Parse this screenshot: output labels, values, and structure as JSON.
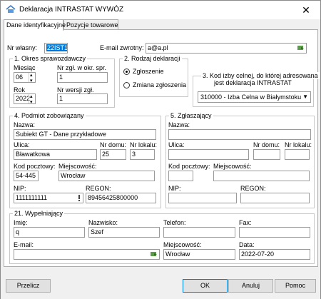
{
  "window": {
    "title": "Deklaracja INTRASTAT WYWÓZ",
    "close": "✕"
  },
  "tabs": [
    {
      "label": "Dane identyfikacyjne"
    },
    {
      "label": "Pozycje towarowe"
    }
  ],
  "header": {
    "own_no_label": "Nr własny:",
    "own_no_value": "22IST1",
    "email_label": "E-mail zwrotny:",
    "email_value": "a@a.pl"
  },
  "period": {
    "title": "1. Okres sprawozdawczy",
    "month_label": "Miesiąc",
    "month_value": "06",
    "report_no_label": "Nr zgł. w okr. spr.",
    "report_no_value": "1",
    "year_label": "Rok",
    "year_value": "2022",
    "version_label": "Nr wersji zgł.",
    "version_value": "1"
  },
  "decl_type": {
    "title": "2. Rodzaj deklaracji",
    "opt1": "Zgłoszenie",
    "opt2": "Zmiana zgłoszenia"
  },
  "customs": {
    "title_line1": "3. Kod izby celnej, do której adresowana",
    "title_line2": "jest deklaracja INTRASTAT",
    "value": "310000 - Izba Celna w Białymstoku"
  },
  "obliged": {
    "title": "4. Podmiot zobowiązany",
    "name_label": "Nazwa:",
    "name_value": "Subiekt GT - Dane przykładowe",
    "street_label": "Ulica:",
    "street_value": "Bławatkowa",
    "house_label": "Nr domu:",
    "house_value": "25",
    "flat_label": "Nr lokalu:",
    "flat_value": "3",
    "zip_label": "Kod pocztowy:",
    "zip_value": "54-445",
    "city_label": "Miejscowość:",
    "city_value": "Wrocław",
    "nip_label": "NIP:",
    "nip_value": "1111111111",
    "regon_label": "REGON:",
    "regon_value": "89456425800000"
  },
  "reporting": {
    "title": "5. Zgłaszający",
    "name_label": "Nazwa:",
    "street_label": "Ulica:",
    "house_label": "Nr domu:",
    "flat_label": "Nr lokalu:",
    "zip_label": "Kod pocztowy:",
    "city_label": "Miejscowość:",
    "nip_label": "NIP:",
    "regon_label": "REGON:"
  },
  "filler": {
    "title": "21. Wypełniający",
    "first_label": "Imię:",
    "first_value": "q",
    "last_label": "Nazwisko:",
    "last_value": "Szef",
    "phone_label": "Telefon:",
    "phone_value": "",
    "fax_label": "Fax:",
    "fax_value": "",
    "email_label": "E-mail:",
    "email_value": "",
    "city_label": "Miejscowość:",
    "city_value": "Wrocław",
    "date_label": "Data:",
    "date_value": "2022-07-20"
  },
  "buttons": {
    "recalc": "Przelicz",
    "ok": "OK",
    "cancel": "Anuluj",
    "help": "Pomoc"
  },
  "colors": {
    "accent": "#0078d7"
  }
}
